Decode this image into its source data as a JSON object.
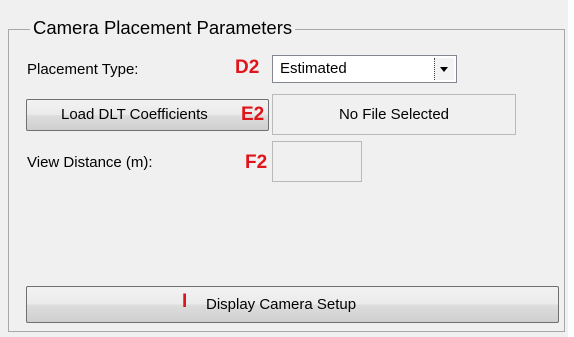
{
  "group": {
    "title": "Camera Placement Parameters"
  },
  "placement": {
    "label": "Placement Type:",
    "selected": "Estimated",
    "annotation": "D2"
  },
  "dlt": {
    "button_label": "Load DLT Coefficients",
    "file_status": "No File Selected",
    "annotation": "E2"
  },
  "view_distance": {
    "label": "View Distance (m):",
    "value": "",
    "annotation": "F2"
  },
  "display": {
    "button_label": "Display Camera Setup",
    "annotation": "I"
  },
  "colors": {
    "annotation": "#e0151b",
    "panel_bg": "#f0f0f0"
  },
  "icons": {
    "dropdown": "chevron-down-icon"
  }
}
